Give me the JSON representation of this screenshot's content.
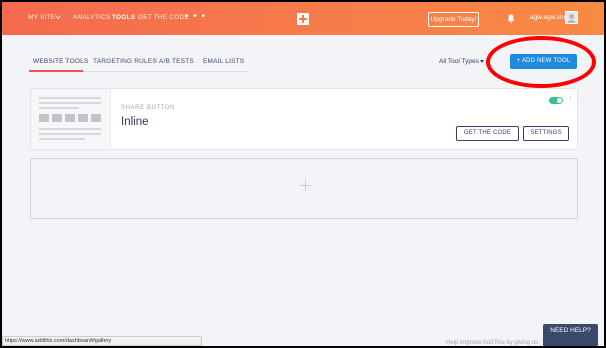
{
  "nav": {
    "site_label": "MY SITE",
    "items": [
      "ANALYTICS",
      "TOOLS",
      "GET THE CODE"
    ],
    "more": "• • •",
    "upgrade_label": "Upgrade Today!",
    "username": "agw.agw.shu",
    "icons": [
      "chevron-down-icon",
      "addthis-logo-icon",
      "bell-icon",
      "avatar-icon",
      "more-icon"
    ]
  },
  "tabs": [
    "WEBSITE TOOLS",
    "TARGETING RULES",
    "A/B TESTS",
    "EMAIL LISTS"
  ],
  "filter": {
    "selected": "All Tool Types"
  },
  "add_tool_label": "+ ADD NEW TOOL",
  "tool_card": {
    "kind": "SHARE BUTTON",
    "title": "Inline",
    "enabled": true,
    "get_code_label": "GET THE CODE",
    "settings_label": "SETTINGS"
  },
  "status_url": "https://www.addthis.com/dashboard#gallery",
  "help_peek": "Help improve AddThis by giving us",
  "need_help_label": "NEED HELP?",
  "colors": {
    "accent": "#1e8bdd",
    "brand": "#f77a4a",
    "toggle_on": "#3cc09a",
    "highlight": "#ff0000"
  }
}
